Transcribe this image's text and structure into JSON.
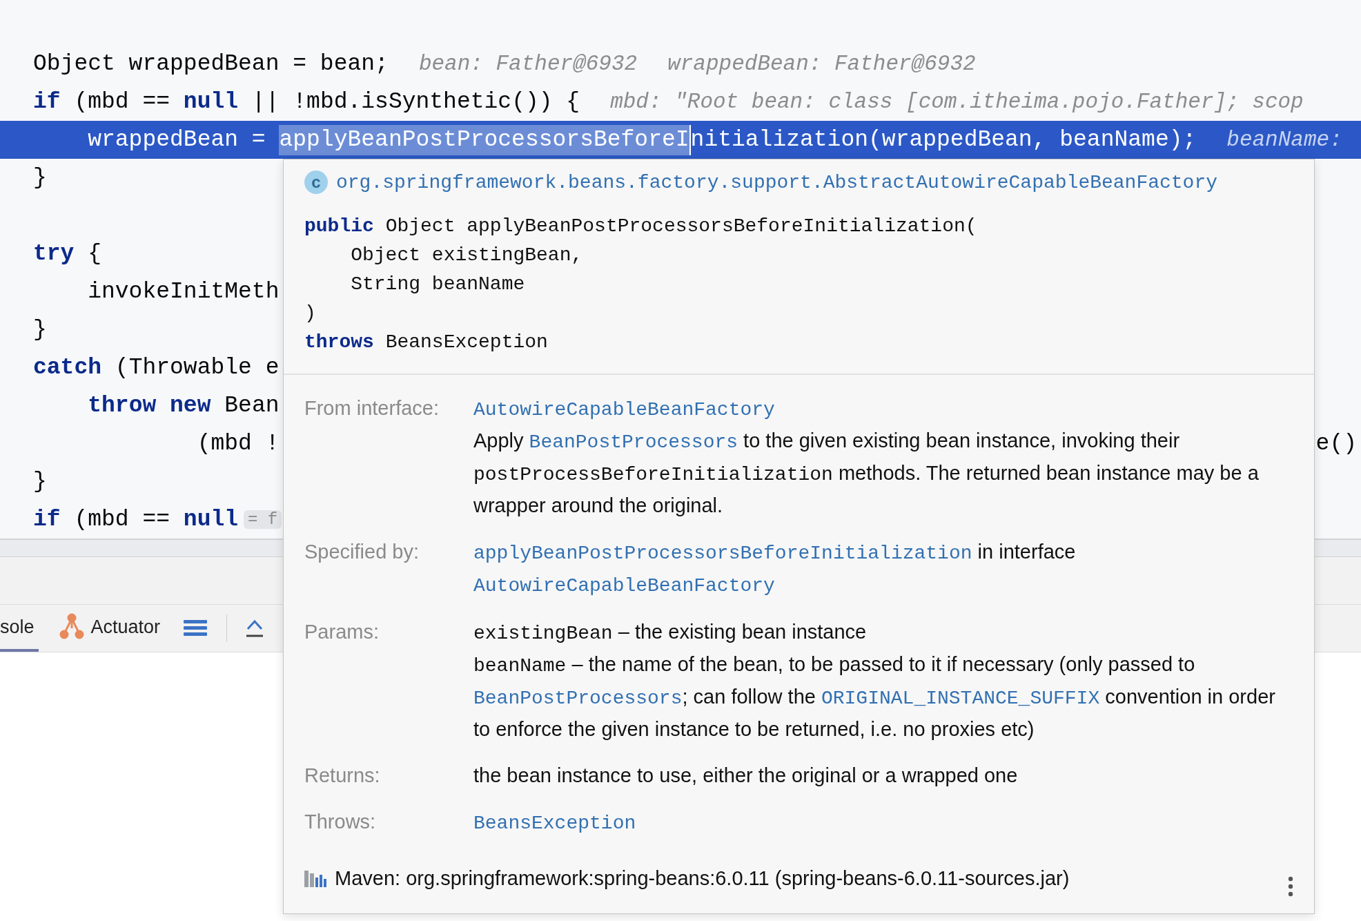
{
  "editor": {
    "lines": [
      {
        "kind": "code",
        "text": "Object wrappedBean = bean;",
        "hints": [
          "bean: Father@6932",
          "wrappedBean: Father@6932"
        ]
      },
      {
        "kind": "code",
        "text": "**if** (mbd == **null** || !mbd.isSynthetic()) {",
        "hints": [
          "mbd: \"Root bean: class [com.itheima.pojo.Father]; scop"
        ]
      },
      {
        "kind": "current",
        "segments": [
          {
            "text": "    wrappedBean = ",
            "selected": false
          },
          {
            "text": "applyBeanPostProcessorsBeforeI",
            "selected": true
          },
          {
            "text": "nitialization(wrappedBean, beanName);",
            "selected": false
          }
        ],
        "hints": [
          "beanName:"
        ]
      },
      {
        "kind": "code",
        "text": "}"
      },
      {
        "kind": "blank"
      },
      {
        "kind": "code",
        "text": "**try** {"
      },
      {
        "kind": "code",
        "text": "    invokeInitMeth"
      },
      {
        "kind": "code",
        "text": "}"
      },
      {
        "kind": "code",
        "text": "**catch** (Throwable e"
      },
      {
        "kind": "code",
        "text": "    **throw** **new** Bean"
      },
      {
        "kind": "code",
        "text": "            (mbd !",
        "right_text": "e()"
      },
      {
        "kind": "code",
        "text": "}"
      },
      {
        "kind": "code",
        "text": "**if** (mbd == **null**",
        "inlay": "= f"
      }
    ]
  },
  "tool_bar": {
    "tabs": [
      {
        "label": "sole",
        "selected": true
      },
      {
        "label": "Actuator",
        "selected": false
      }
    ]
  },
  "doc_popup": {
    "class_badge": "c",
    "class_name": "org.springframework.beans.factory.support.AbstractAutowireCapableBeanFactory",
    "signature": [
      "**public** Object applyBeanPostProcessorsBeforeInitialization(",
      "    Object existingBean,",
      "    String beanName",
      ")",
      "**throws** BeansException"
    ],
    "sections": [
      {
        "label": "From interface:",
        "blocks": [
          [
            {
              "kind": "link",
              "text": "AutowireCapableBeanFactory"
            }
          ],
          [
            {
              "kind": "text",
              "text": "Apply "
            },
            {
              "kind": "link",
              "text": "BeanPostProcessors"
            },
            {
              "kind": "text",
              "text": " to the given existing bean instance, invoking their "
            },
            {
              "kind": "code",
              "text": "postProcessBeforeInitialization"
            },
            {
              "kind": "text",
              "text": " methods. The returned bean instance may be a wrapper around the original."
            }
          ]
        ]
      },
      {
        "label": "Specified by:",
        "blocks": [
          [
            {
              "kind": "link",
              "text": "applyBeanPostProcessorsBeforeInitialization"
            },
            {
              "kind": "text",
              "text": " in interface "
            },
            {
              "kind": "link",
              "text": "AutowireCapableBeanFactory"
            }
          ]
        ]
      },
      {
        "label": "Params:",
        "blocks": [
          [
            {
              "kind": "code",
              "text": "existingBean"
            },
            {
              "kind": "text",
              "text": " – the existing bean instance"
            }
          ],
          [
            {
              "kind": "code",
              "text": "beanName"
            },
            {
              "kind": "text",
              "text": " – the name of the bean, to be passed to it if necessary (only passed to "
            },
            {
              "kind": "link",
              "text": "BeanPostProcessors"
            },
            {
              "kind": "text",
              "text": "; can follow the "
            },
            {
              "kind": "link",
              "text": "ORIGINAL_INSTANCE_SUFFIX"
            },
            {
              "kind": "text",
              "text": " convention in order to enforce the given instance to be returned, i.e. no proxies etc)"
            }
          ]
        ]
      },
      {
        "label": "Returns:",
        "blocks": [
          [
            {
              "kind": "text",
              "text": "the bean instance to use, either the original or a wrapped one"
            }
          ]
        ]
      },
      {
        "label": "Throws:",
        "blocks": [
          [
            {
              "kind": "link",
              "text": "BeansException"
            }
          ]
        ]
      }
    ],
    "footer": "Maven: org.springframework:spring-beans:6.0.11 (spring-beans-6.0.11-sources.jar)"
  }
}
